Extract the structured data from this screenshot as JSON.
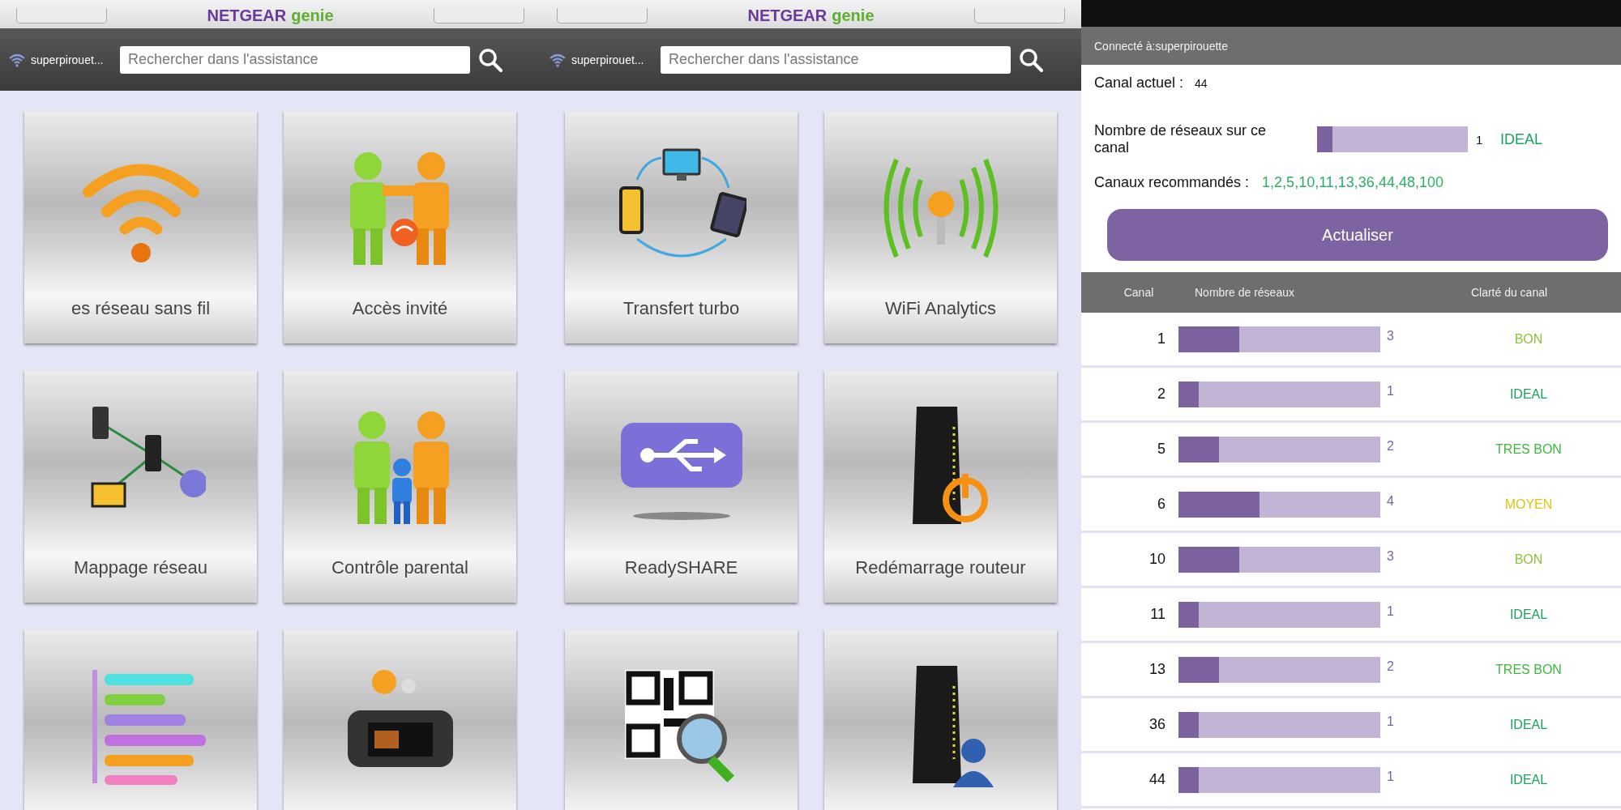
{
  "screens": [
    {
      "logo": {
        "brand": "NETGEAR",
        "product": "genie"
      },
      "network": "superpirouet...",
      "search": {
        "placeholder": "Rechercher dans l'assistance"
      },
      "tiles": [
        {
          "kind": "wifi",
          "label": "es réseau sans fil"
        },
        {
          "kind": "guest",
          "label": "Accès invité"
        },
        {
          "kind": "netmap",
          "label": "Mappage réseau"
        },
        {
          "kind": "family",
          "label": "Contrôle parental"
        },
        {
          "kind": "bars"
        },
        {
          "kind": "media"
        }
      ]
    },
    {
      "logo": {
        "brand": "NETGEAR",
        "product": "genie"
      },
      "network": "superpirouet...",
      "search": {
        "placeholder": "Rechercher dans l'assistance"
      },
      "tiles": [
        {
          "kind": "transfer",
          "label": "Transfert turbo"
        },
        {
          "kind": "analytics",
          "label": "WiFi Analytics"
        },
        {
          "kind": "usb",
          "label": "ReadySHARE"
        },
        {
          "kind": "router",
          "label": "Redémarrage routeur"
        },
        {
          "kind": "qr"
        },
        {
          "kind": "routeruser"
        }
      ]
    }
  ],
  "analytics": {
    "connected": "Connecté à:superpirouette",
    "current_label": "Canal actuel :",
    "current_value": "44",
    "networks_label": "Nombre de réseaux sur ce canal",
    "networks": {
      "level": 0.1,
      "count": "1",
      "status": "IDEAL",
      "color": "#1aa260"
    },
    "recommended_label": "Canaux recommandés :",
    "recommended": "1,2,5,10,11,13,36,44,48,100",
    "refresh_button": "Actualiser",
    "table": {
      "columns": [
        "Canal",
        "Nombre de réseaux",
        "Clarté du canal"
      ],
      "rows": [
        {
          "channel": "1",
          "level": 0.3,
          "count": "3",
          "status": "BON",
          "color": "#8cc43c"
        },
        {
          "channel": "2",
          "level": 0.1,
          "count": "1",
          "status": "IDEAL",
          "color": "#1aa260"
        },
        {
          "channel": "5",
          "level": 0.2,
          "count": "2",
          "status": "TRES BON",
          "color": "#3cb83c"
        },
        {
          "channel": "6",
          "level": 0.4,
          "count": "4",
          "status": "MOYEN",
          "color": "#e0c414"
        },
        {
          "channel": "10",
          "level": 0.3,
          "count": "3",
          "status": "BON",
          "color": "#8cc43c"
        },
        {
          "channel": "11",
          "level": 0.1,
          "count": "1",
          "status": "IDEAL",
          "color": "#1aa260"
        },
        {
          "channel": "13",
          "level": 0.2,
          "count": "2",
          "status": "TRES BON",
          "color": "#3cb83c"
        },
        {
          "channel": "36",
          "level": 0.1,
          "count": "1",
          "status": "IDEAL",
          "color": "#1aa260"
        },
        {
          "channel": "44",
          "level": 0.1,
          "count": "1",
          "status": "IDEAL",
          "color": "#1aa260"
        }
      ]
    }
  }
}
